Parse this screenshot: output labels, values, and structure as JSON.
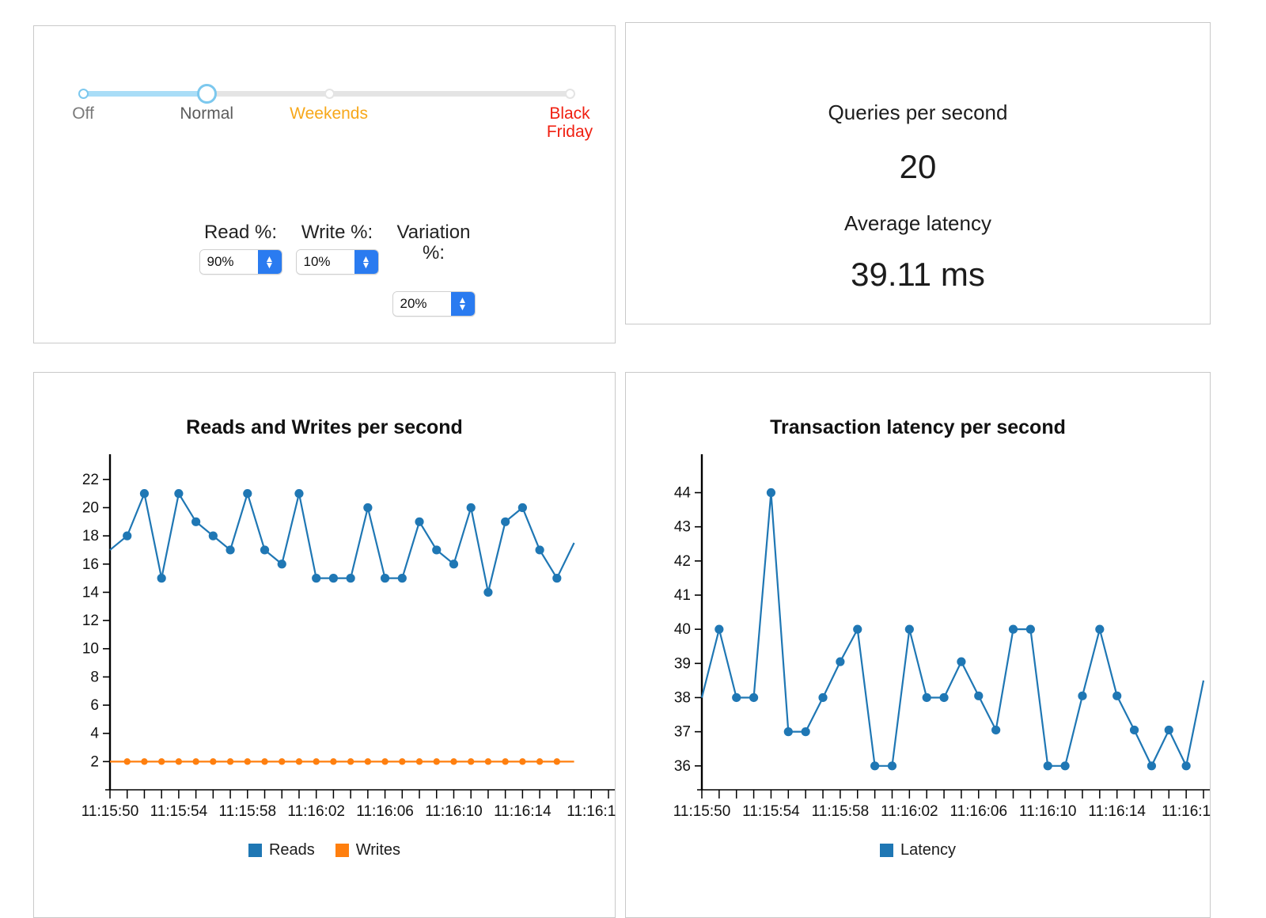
{
  "controls": {
    "slider": {
      "name": "load-profile-slider",
      "selected": "Normal",
      "selected_index": 1,
      "stops": [
        {
          "label": "Off",
          "color": "#7a7a7a",
          "position": 0
        },
        {
          "label": "Normal",
          "color": "#5c5c5c",
          "position": 25.4
        },
        {
          "label": "Weekends",
          "color": "#f7a81b",
          "position": 50.5
        },
        {
          "label": "Black Friday",
          "color": "#f01f10",
          "position": 100
        }
      ],
      "fill_color": "#a9ddf7",
      "track_color": "#e4e4e4"
    },
    "fields": [
      {
        "label": "Read %:",
        "value": "90%"
      },
      {
        "label": "Write %:",
        "value": "10%"
      },
      {
        "label": "Variation %:",
        "value": "20%"
      }
    ]
  },
  "stats": {
    "qps_label": "Queries per second",
    "qps_value": "20",
    "latency_label": "Average latency",
    "latency_value": "39.11 ms"
  },
  "chart_data": [
    {
      "id": "reads-writes",
      "type": "line",
      "title": "Reads and Writes per second",
      "xlabel": "",
      "ylabel": "",
      "ylim": [
        0,
        23
      ],
      "yticks": [
        2,
        4,
        6,
        8,
        10,
        12,
        14,
        16,
        18,
        20,
        22
      ],
      "grid": false,
      "legend_position": "bottom",
      "x_tick_labels": [
        "11:15:50",
        "11:15:54",
        "11:15:58",
        "11:16:02",
        "11:16:06",
        "11:16:10",
        "11:16:14",
        "11:16:1"
      ],
      "x_tick_label_every": 4,
      "n_points": 30,
      "series": [
        {
          "name": "Reads",
          "color": "#1f77b4",
          "values": [
            17,
            18,
            21,
            15,
            21,
            19,
            18,
            17,
            21,
            17,
            16,
            21,
            15,
            15,
            15,
            20,
            15,
            15,
            19,
            17,
            16,
            20,
            14,
            19,
            20,
            17,
            15,
            17.5
          ]
        },
        {
          "name": "Writes",
          "color": "#ff7f0e",
          "values": [
            2,
            2,
            2,
            2,
            2,
            2,
            2,
            2,
            2,
            2,
            2,
            2,
            2,
            2,
            2,
            2,
            2,
            2,
            2,
            2,
            2,
            2,
            2,
            2,
            2,
            2,
            2,
            2
          ]
        }
      ]
    },
    {
      "id": "transaction-latency",
      "type": "line",
      "title": "Transaction latency per second",
      "xlabel": "",
      "ylabel": "",
      "ylim": [
        35.3,
        44.8
      ],
      "yticks": [
        36,
        37,
        38,
        39,
        40,
        41,
        42,
        43,
        44
      ],
      "grid": false,
      "legend_position": "bottom",
      "x_tick_labels": [
        "11:15:50",
        "11:15:54",
        "11:15:58",
        "11:16:02",
        "11:16:06",
        "11:16:10",
        "11:16:14",
        "11:16:1"
      ],
      "x_tick_label_every": 4,
      "n_points": 30,
      "series": [
        {
          "name": "Latency",
          "color": "#1f77b4",
          "values": [
            38,
            40,
            38,
            38,
            44,
            37,
            37,
            38,
            39.05,
            40,
            36,
            36,
            40,
            38,
            38,
            39.05,
            38.05,
            37.05,
            40,
            40,
            36,
            36,
            38.05,
            40,
            38.05,
            37.05,
            36,
            37.05,
            36,
            38.5
          ]
        }
      ]
    }
  ]
}
